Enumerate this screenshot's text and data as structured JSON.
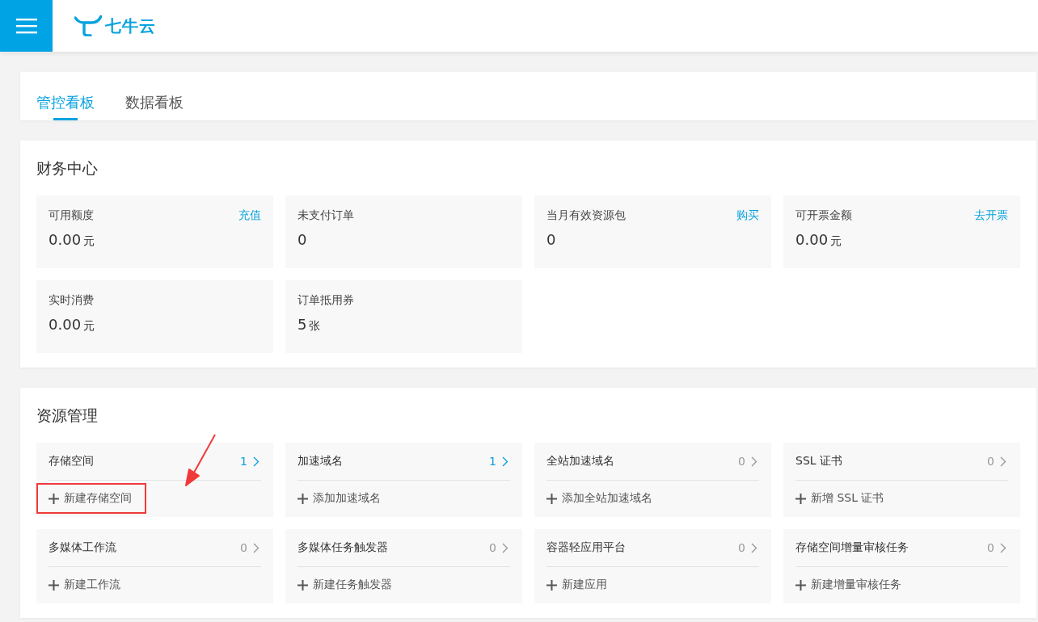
{
  "header": {
    "logo_text": "七牛云"
  },
  "tabs": [
    {
      "label": "管控看板",
      "selected": true
    },
    {
      "label": "数据看板",
      "selected": false
    }
  ],
  "finance": {
    "title": "财务中心",
    "stats": [
      {
        "label": "可用额度",
        "value": "0.00",
        "unit": "元",
        "action": "充值"
      },
      {
        "label": "未支付订单",
        "value": "0"
      },
      {
        "label": "当月有效资源包",
        "value": "0",
        "action": "购买"
      },
      {
        "label": "可开票金额",
        "value": "0.00",
        "unit": "元",
        "action": "去开票"
      },
      {
        "label": "实时消费",
        "value": "0.00",
        "unit": "元"
      },
      {
        "label": "订单抵用券",
        "value": "5",
        "unit": "张"
      }
    ]
  },
  "resources": {
    "title": "资源管理",
    "items": [
      {
        "name": "存储空间",
        "count": "1",
        "emphasized": true,
        "action": "新建存储空间",
        "highlighted": true
      },
      {
        "name": "加速域名",
        "count": "1",
        "emphasized": true,
        "action": "添加加速域名",
        "highlighted": false
      },
      {
        "name": "全站加速域名",
        "count": "0",
        "emphasized": false,
        "action": "添加全站加速域名",
        "highlighted": false
      },
      {
        "name": "SSL 证书",
        "count": "0",
        "emphasized": false,
        "action": "新增 SSL 证书",
        "highlighted": false
      },
      {
        "name": "多媒体工作流",
        "count": "0",
        "emphasized": false,
        "action": "新建工作流",
        "highlighted": false
      },
      {
        "name": "多媒体任务触发器",
        "count": "0",
        "emphasized": false,
        "action": "新建任务触发器",
        "highlighted": false
      },
      {
        "name": "容器轻应用平台",
        "count": "0",
        "emphasized": false,
        "action": "新建应用",
        "highlighted": false
      },
      {
        "name": "存储空间增量审核任务",
        "count": "0",
        "emphasized": false,
        "action": "新建增量审核任务",
        "highlighted": false
      }
    ]
  }
}
